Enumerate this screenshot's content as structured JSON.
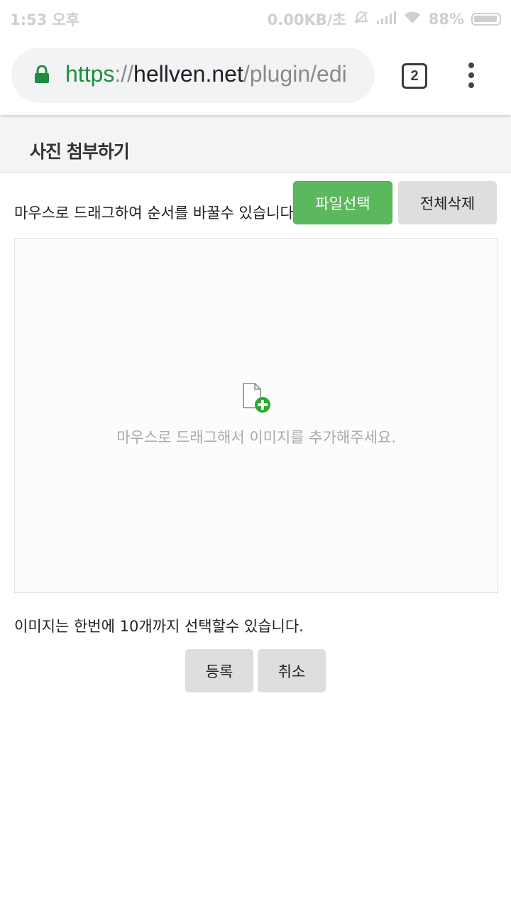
{
  "status_bar": {
    "time": "1:53 오후",
    "network_speed": "0.00KB/초",
    "battery": "88%"
  },
  "browser": {
    "url_scheme": "https",
    "url_separator": "://",
    "url_host": "hellven.net",
    "url_path": "/plugin/edi",
    "tab_count": "2"
  },
  "page": {
    "title": "사진 첨부하기",
    "hint": "마우스로 드래그하여 순서를 바꿀수 있습니다.",
    "file_select_label": "파일선택",
    "delete_all_label": "전체삭제",
    "dropzone_text": "마우스로 드래그해서 이미지를 추가해주세요.",
    "limit_text": "이미지는 한번에 10개까지 선택할수 있습니다.",
    "register_label": "등록",
    "cancel_label": "취소"
  },
  "colors": {
    "accent_green": "#5cb85c",
    "button_gray": "#dedede",
    "url_green": "#1e8e3e"
  }
}
